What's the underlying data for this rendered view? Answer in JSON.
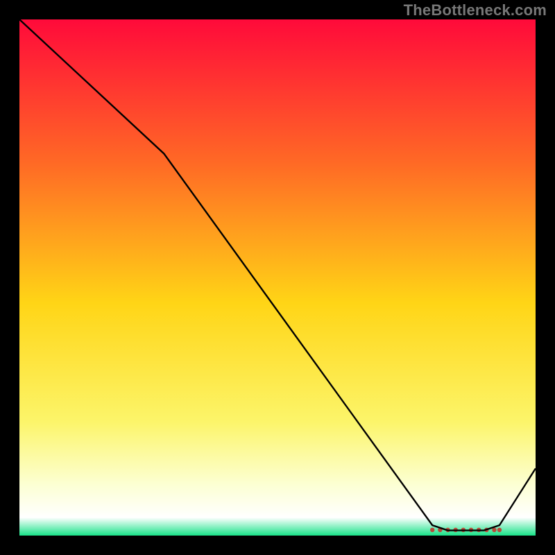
{
  "watermark": "TheBottleneck.com",
  "chart_data": {
    "type": "line",
    "title": "",
    "xlabel": "",
    "ylabel": "",
    "xlim": [
      0,
      100
    ],
    "ylim": [
      0,
      100
    ],
    "grid": false,
    "legend": false,
    "background_gradient": {
      "stops": [
        {
          "pos": 0.0,
          "color": "#ff0a3a"
        },
        {
          "pos": 0.28,
          "color": "#ff6a25"
        },
        {
          "pos": 0.55,
          "color": "#ffd516"
        },
        {
          "pos": 0.78,
          "color": "#fcf56a"
        },
        {
          "pos": 0.9,
          "color": "#fcffd2"
        },
        {
          "pos": 0.965,
          "color": "#ffffff"
        },
        {
          "pos": 1.0,
          "color": "#19e389"
        }
      ]
    },
    "series": [
      {
        "name": "bottleneck-curve",
        "color": "#000000",
        "x": [
          0,
          28,
          80,
          83,
          90,
          93,
          100
        ],
        "y": [
          100,
          74,
          2,
          1,
          1,
          2,
          13
        ]
      }
    ],
    "flat_segment_dots": {
      "color": "#b84a3a",
      "y": 1.1,
      "x": [
        80,
        81.5,
        83,
        84.5,
        86,
        87.5,
        89,
        90.5,
        92,
        93
      ]
    }
  }
}
